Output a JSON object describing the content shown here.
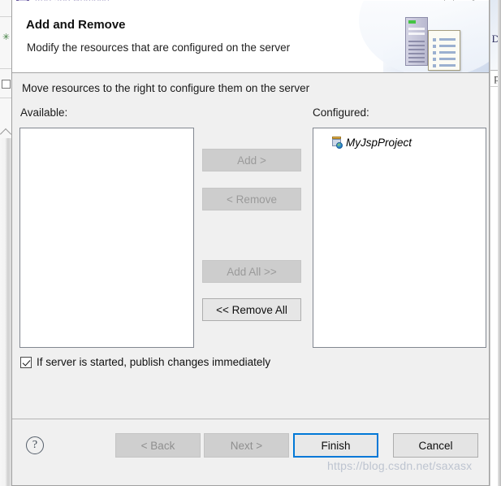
{
  "window": {
    "title": "Add and Remove...",
    "icon": "eclipse-icon",
    "minimize_label": "",
    "maximize_label": "",
    "close_label": "✕"
  },
  "header": {
    "title": "Add and Remove",
    "description": "Modify the resources that are configured on the server",
    "art_icons": [
      "server-tower-icon",
      "document-icon"
    ]
  },
  "body": {
    "instruction": "Move resources to the right to configure them on the server",
    "available": {
      "label": "Available:",
      "items": []
    },
    "configured": {
      "label": "Configured:",
      "items": [
        {
          "label": "MyJspProject",
          "icon": "project-jar-icon"
        }
      ]
    },
    "transfer_buttons": [
      {
        "label": "Add >",
        "enabled": false
      },
      {
        "label": "< Remove",
        "enabled": false
      },
      {
        "label": "Add All >>",
        "enabled": false
      },
      {
        "label": "<< Remove All",
        "enabled": true
      }
    ],
    "publish_checkbox": {
      "label": "If server is started, publish changes immediately",
      "checked": true
    }
  },
  "footer": {
    "help_label": "?",
    "buttons": [
      {
        "label": "< Back",
        "enabled": false,
        "focused": false
      },
      {
        "label": "Next >",
        "enabled": false,
        "focused": false
      },
      {
        "label": "Finish",
        "enabled": true,
        "focused": true
      },
      {
        "label": "Cancel",
        "enabled": true,
        "focused": false
      }
    ]
  },
  "watermark": "https://blog.csdn.net/saxasx",
  "background": {
    "right_letter_1": "D",
    "right_letter_2": "p"
  },
  "colors": {
    "dialog_bg": "#f0f0f0",
    "accent_focus": "#0078d7",
    "text": "#111111",
    "disabled_text": "#9a9a9a",
    "title_text": "#b9b4d2"
  }
}
